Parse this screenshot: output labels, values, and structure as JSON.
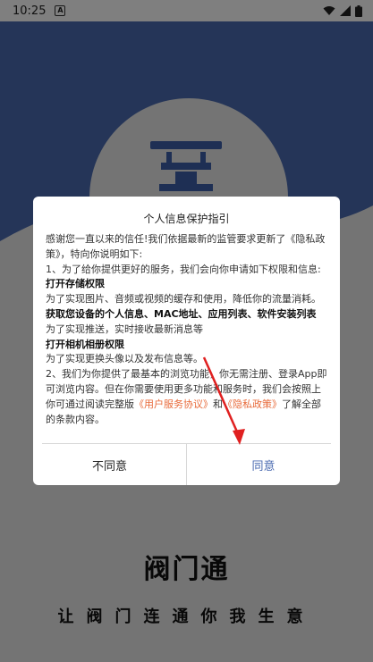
{
  "status_bar": {
    "time": "10:25",
    "notification_icon": "a-icon"
  },
  "splash": {
    "app_name": "阀门通",
    "slogan": "让阀门连通你我生意"
  },
  "dialog": {
    "title": "个人信息保护指引",
    "intro": "感谢您一直以来的信任!我们依据最新的监管要求更新了《隐私政策》，特向你说明如下:",
    "point1": "1、为了给你提供更好的服务，我们会向你申请如下权限和信息:",
    "perm1_title": "打开存储权限",
    "perm1_desc": "为了实现图片、音频或视频的缓存和使用，降低你的流量消耗。",
    "perm2_title": "获取您设备的个人信息、MAC地址、应用列表、软件安装列表",
    "perm2_desc": "为了实现推送，实时接收最新消息等",
    "perm3_title": "打开相机相册权限",
    "perm3_desc": "为了实现更换头像以及发布信息等。",
    "point2": "2、我们为你提供了最基本的浏览功能，你无需注册、登录App即可浏览内容。但在你需要使用更多功能和服务时，我们会按照上",
    "point2_b": "你可通过阅读完整版",
    "link_user_agreement": "《用户服务协议》",
    "and_text": "和",
    "link_privacy": "《隐私政策》",
    "tail": "了解全部的条款内容。",
    "btn_disagree": "不同意",
    "btn_agree": "同意"
  },
  "colors": {
    "brand": "#4a6ab0",
    "link": "#e86a3a",
    "arrow": "#e02020"
  }
}
